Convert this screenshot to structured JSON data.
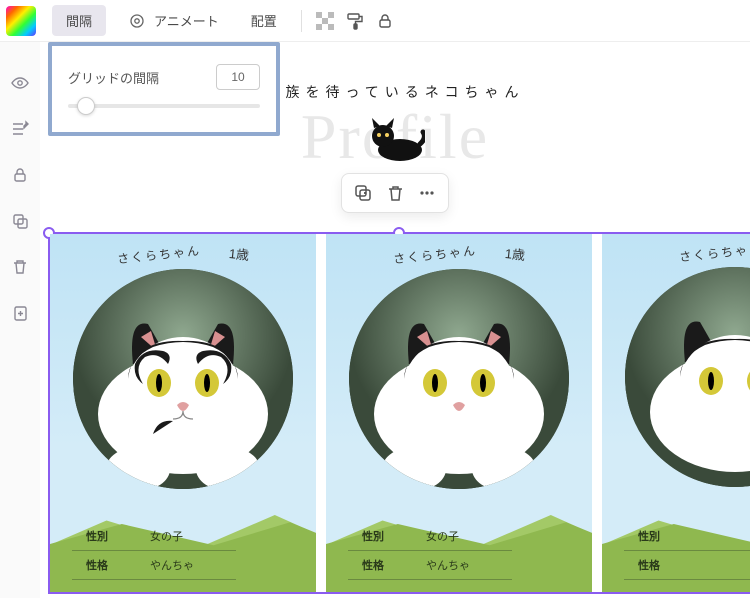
{
  "topbar": {
    "tab_spacing": "間隔",
    "tab_animate": "アニメート",
    "tab_position": "配置"
  },
  "popover": {
    "label": "グリッドの間隔",
    "value": "10"
  },
  "hero": {
    "title": "家族を待っているネコちゃん",
    "script": "Profile"
  },
  "cards": [
    {
      "name": "さくらちゃん",
      "age": "1歳",
      "rows": [
        [
          "性別",
          "女の子"
        ],
        [
          "性格",
          "やんちゃ"
        ]
      ]
    },
    {
      "name": "さくらちゃん",
      "age": "1歳",
      "rows": [
        [
          "性別",
          "女の子"
        ],
        [
          "性格",
          "やんちゃ"
        ]
      ]
    },
    {
      "name": "さくらちゃん",
      "age": "",
      "rows": [
        [
          "性別",
          ""
        ],
        [
          "性格",
          ""
        ]
      ]
    }
  ]
}
